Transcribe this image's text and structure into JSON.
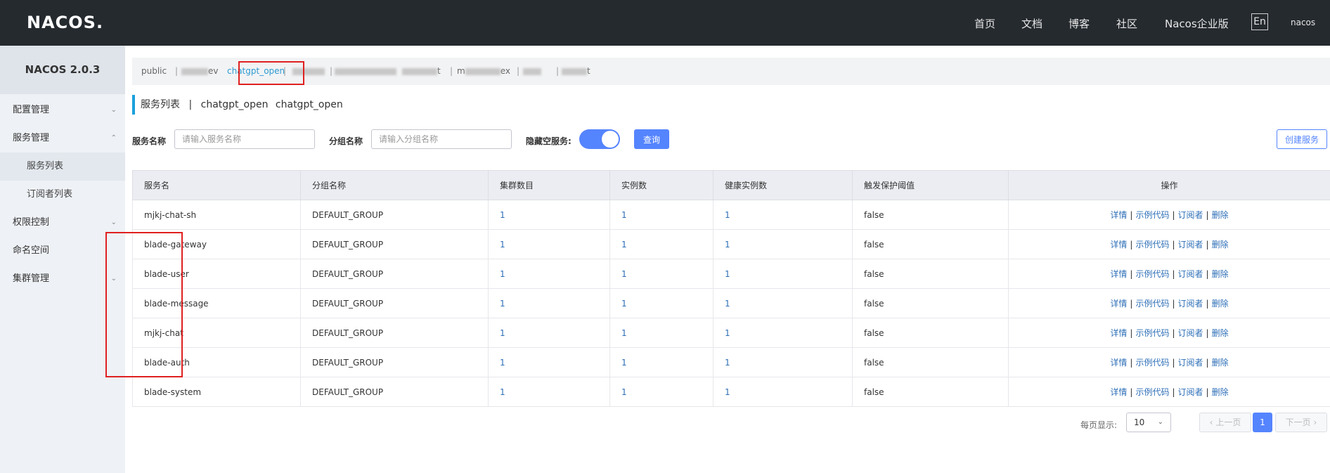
{
  "header": {
    "logo": "NACOS.",
    "nav": [
      "首页",
      "文档",
      "博客",
      "社区",
      "Nacos企业版"
    ],
    "lang": "En",
    "user": "nacos"
  },
  "sidebar": {
    "title": "NACOS 2.0.3",
    "items": [
      {
        "label": "配置管理"
      },
      {
        "label": "服务管理"
      },
      {
        "label": "服务列表"
      },
      {
        "label": "订阅者列表"
      },
      {
        "label": "权限控制"
      },
      {
        "label": "命名空间"
      },
      {
        "label": "集群管理"
      }
    ]
  },
  "namespaces": {
    "items": [
      {
        "label": "public"
      },
      {
        "label": "ev"
      },
      {
        "label": "chatgpt_open"
      },
      {
        "label": "t"
      },
      {
        "label": "m"
      },
      {
        "label": "ex"
      },
      {
        "label": "t"
      }
    ],
    "separator": "|"
  },
  "page": {
    "title": "服务列表",
    "separator": "|",
    "namespace_name": "chatgpt_open",
    "namespace_id": "chatgpt_open"
  },
  "filters": {
    "service_label": "服务名称",
    "service_placeholder": "请输入服务名称",
    "group_label": "分组名称",
    "group_placeholder": "请输入分组名称",
    "hide_empty_label": "隐藏空服务:",
    "query_button": "查询",
    "create_button": "创建服务"
  },
  "table": {
    "headers": [
      "服务名",
      "分组名称",
      "集群数目",
      "实例数",
      "健康实例数",
      "触发保护阈值",
      "操作"
    ],
    "ops": [
      "详情",
      "示例代码",
      "订阅者",
      "删除"
    ],
    "op_sep": "|",
    "rows": [
      {
        "name": "mjkj-chat-sh",
        "group": "DEFAULT_GROUP",
        "clusters": "1",
        "instances": "1",
        "healthy": "1",
        "protect": "false"
      },
      {
        "name": "blade-gateway",
        "group": "DEFAULT_GROUP",
        "clusters": "1",
        "instances": "1",
        "healthy": "1",
        "protect": "false"
      },
      {
        "name": "blade-user",
        "group": "DEFAULT_GROUP",
        "clusters": "1",
        "instances": "1",
        "healthy": "1",
        "protect": "false"
      },
      {
        "name": "blade-message",
        "group": "DEFAULT_GROUP",
        "clusters": "1",
        "instances": "1",
        "healthy": "1",
        "protect": "false"
      },
      {
        "name": "mjkj-chat",
        "group": "DEFAULT_GROUP",
        "clusters": "1",
        "instances": "1",
        "healthy": "1",
        "protect": "false"
      },
      {
        "name": "blade-auth",
        "group": "DEFAULT_GROUP",
        "clusters": "1",
        "instances": "1",
        "healthy": "1",
        "protect": "false"
      },
      {
        "name": "blade-system",
        "group": "DEFAULT_GROUP",
        "clusters": "1",
        "instances": "1",
        "healthy": "1",
        "protect": "false"
      }
    ]
  },
  "pager": {
    "page_size_label": "每页显示:",
    "page_size": "10",
    "prev": "上一页",
    "next": "下一页",
    "current": "1"
  },
  "colors": {
    "topbar": "#252a2f",
    "primary": "#5584ff",
    "link": "#2e6fb7",
    "highlight": "#e02020"
  }
}
